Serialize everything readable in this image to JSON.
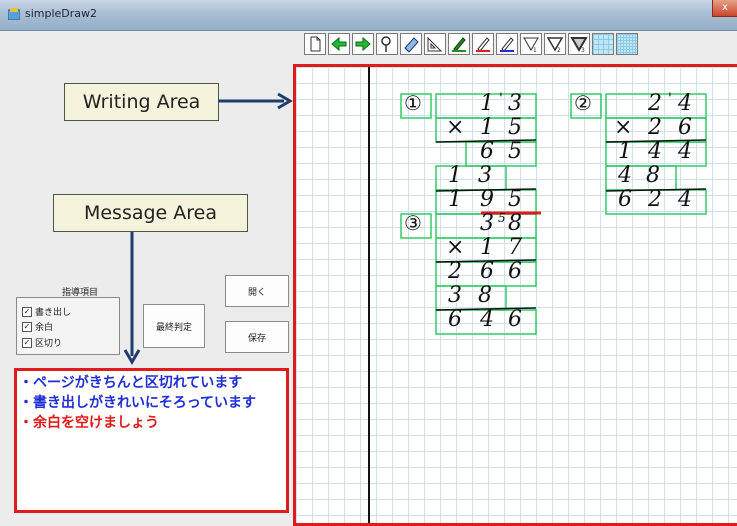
{
  "window": {
    "title": "simpleDraw2",
    "close_glyph": "x"
  },
  "toolbar": {
    "tools": [
      "new-page-icon",
      "arrow-left-icon",
      "arrow-right-icon",
      "magnifier-icon",
      "eraser-icon",
      "ruler-triangle-icon",
      "pen-green-icon",
      "pen-red-icon",
      "pen-blue-icon",
      "line-width-1-icon",
      "line-width-2-icon",
      "line-width-3-icon",
      "grid-large-icon",
      "grid-small-icon"
    ],
    "width_labels": [
      "1",
      "2",
      "3"
    ]
  },
  "labels": {
    "writing_area": "Writing Area",
    "message_area": "Message Area"
  },
  "guidance": {
    "title": "指導項目",
    "items": [
      {
        "label": "書き出し",
        "checked": true
      },
      {
        "label": "余白",
        "checked": true
      },
      {
        "label": "区切り",
        "checked": true
      }
    ]
  },
  "buttons": {
    "final_judgment": "最終判定",
    "open": "開く",
    "save": "保存"
  },
  "messages": [
    {
      "text": "・ページがきちんと区切れています",
      "color": "#1f2fd6"
    },
    {
      "text": "・書き出しがきれいにそろっています",
      "color": "#1f2fd6"
    },
    {
      "text": "・余白を空けましょう",
      "color": "#e01b1b"
    }
  ],
  "problems": {
    "p1": {
      "number": "①",
      "row1": [
        "1",
        "3"
      ],
      "row2": [
        "×",
        "1",
        "5"
      ],
      "row3": [
        "6",
        "5"
      ],
      "row4": [
        "1",
        "3"
      ],
      "row5": [
        "1",
        "9",
        "5"
      ],
      "carry": "'"
    },
    "p2": {
      "number": "②",
      "row1": [
        "2",
        "4"
      ],
      "row2": [
        "×",
        "2",
        "6"
      ],
      "row3": [
        "1",
        "4",
        "4"
      ],
      "row4": [
        "4",
        "8"
      ],
      "row5": [
        "6",
        "2",
        "4"
      ],
      "carry": "'"
    },
    "p3": {
      "number": "③",
      "row1": [
        "3",
        "8"
      ],
      "row2": [
        "×",
        "1",
        "7"
      ],
      "row3": [
        "2",
        "6",
        "6"
      ],
      "row4": [
        "3",
        "8"
      ],
      "row5": [
        "6",
        "4",
        "6"
      ],
      "carry": "5"
    }
  },
  "colors": {
    "accent_red": "#e01b1b",
    "box_green": "#33cc66",
    "message_blue": "#1f2fd6"
  }
}
